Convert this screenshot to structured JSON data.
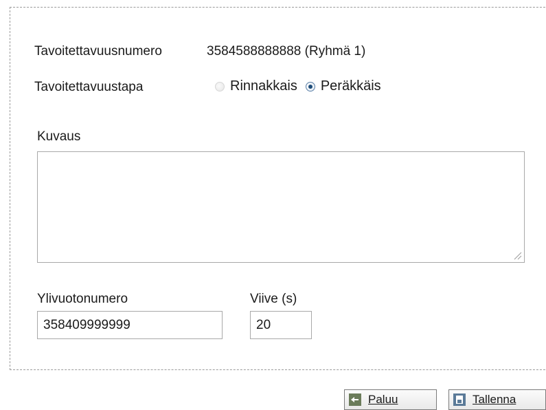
{
  "reach_number": {
    "label": "Tavoitettavuusnumero",
    "value": "3584588888888 (Ryhmä 1)"
  },
  "reach_mode": {
    "label": "Tavoitettavuustapa",
    "options": [
      {
        "label": "Rinnakkais",
        "selected": false,
        "disabled": true
      },
      {
        "label": "Peräkkäis",
        "selected": true,
        "disabled": false
      }
    ]
  },
  "description": {
    "label": "Kuvaus",
    "value": ""
  },
  "overflow_number": {
    "label": "Ylivuotonumero",
    "value": "358409999999"
  },
  "delay": {
    "label": "Viive (s)",
    "value": "20"
  },
  "buttons": {
    "back_label": "Paluu",
    "save_label": "Tallenna"
  },
  "colors": {
    "back_icon": "#6b7c5a",
    "save_icon": "#5b7a98",
    "frame_border": "#9a9a9a"
  }
}
